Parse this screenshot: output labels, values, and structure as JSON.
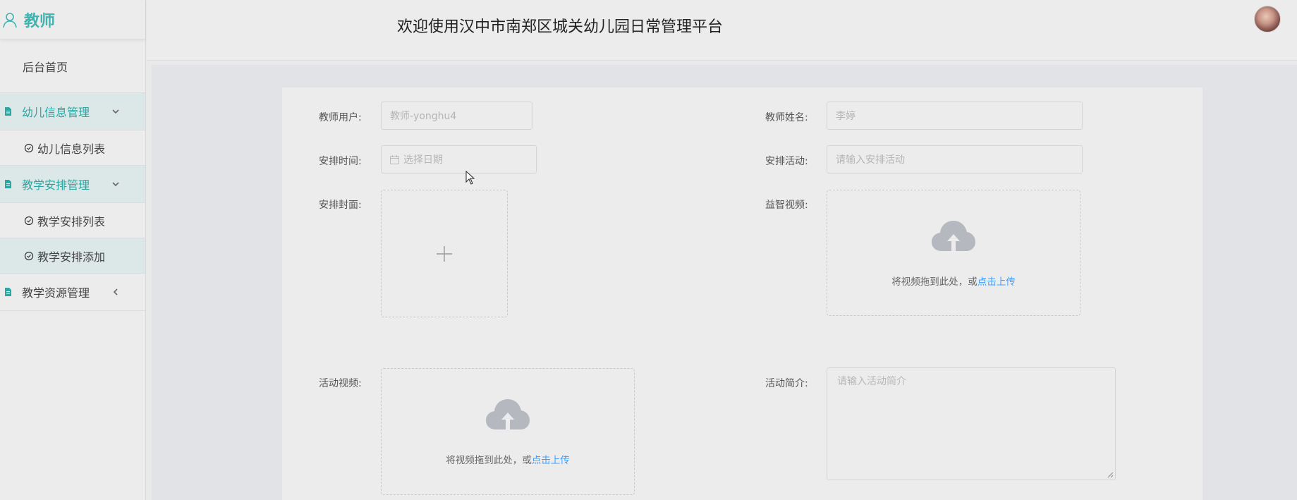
{
  "sidebar": {
    "brand": "教师",
    "home": "后台首页",
    "groups": [
      {
        "label": "幼儿信息管理",
        "items": [
          "幼儿信息列表"
        ]
      },
      {
        "label": "教学安排管理",
        "items": [
          "教学安排列表",
          "教学安排添加"
        ]
      },
      {
        "label": "教学资源管理",
        "items": []
      }
    ]
  },
  "header": {
    "title": "欢迎使用汉中市南郑区城关幼儿园日常管理平台"
  },
  "form": {
    "teacher_user": {
      "label": "教师用户:",
      "value": "教师-yonghu4"
    },
    "teacher_name": {
      "label": "教师姓名:",
      "value": "李婷"
    },
    "schedule_time": {
      "label": "安排时间:",
      "placeholder": "选择日期"
    },
    "schedule_activity": {
      "label": "安排活动:",
      "placeholder": "请输入安排活动"
    },
    "cover": {
      "label": "安排封面:"
    },
    "edu_video": {
      "label": "益智视频:",
      "drop_text": "将视频拖到此处，或",
      "link_text": "点击上传"
    },
    "activity_video": {
      "label": "活动视频:",
      "drop_text": "将视频拖到此处，或",
      "link_text": "点击上传"
    },
    "activity_intro": {
      "label": "活动简介:",
      "placeholder": "请输入活动简介"
    }
  },
  "colors": {
    "accent": "#3fb3b0",
    "link": "#409eff"
  }
}
